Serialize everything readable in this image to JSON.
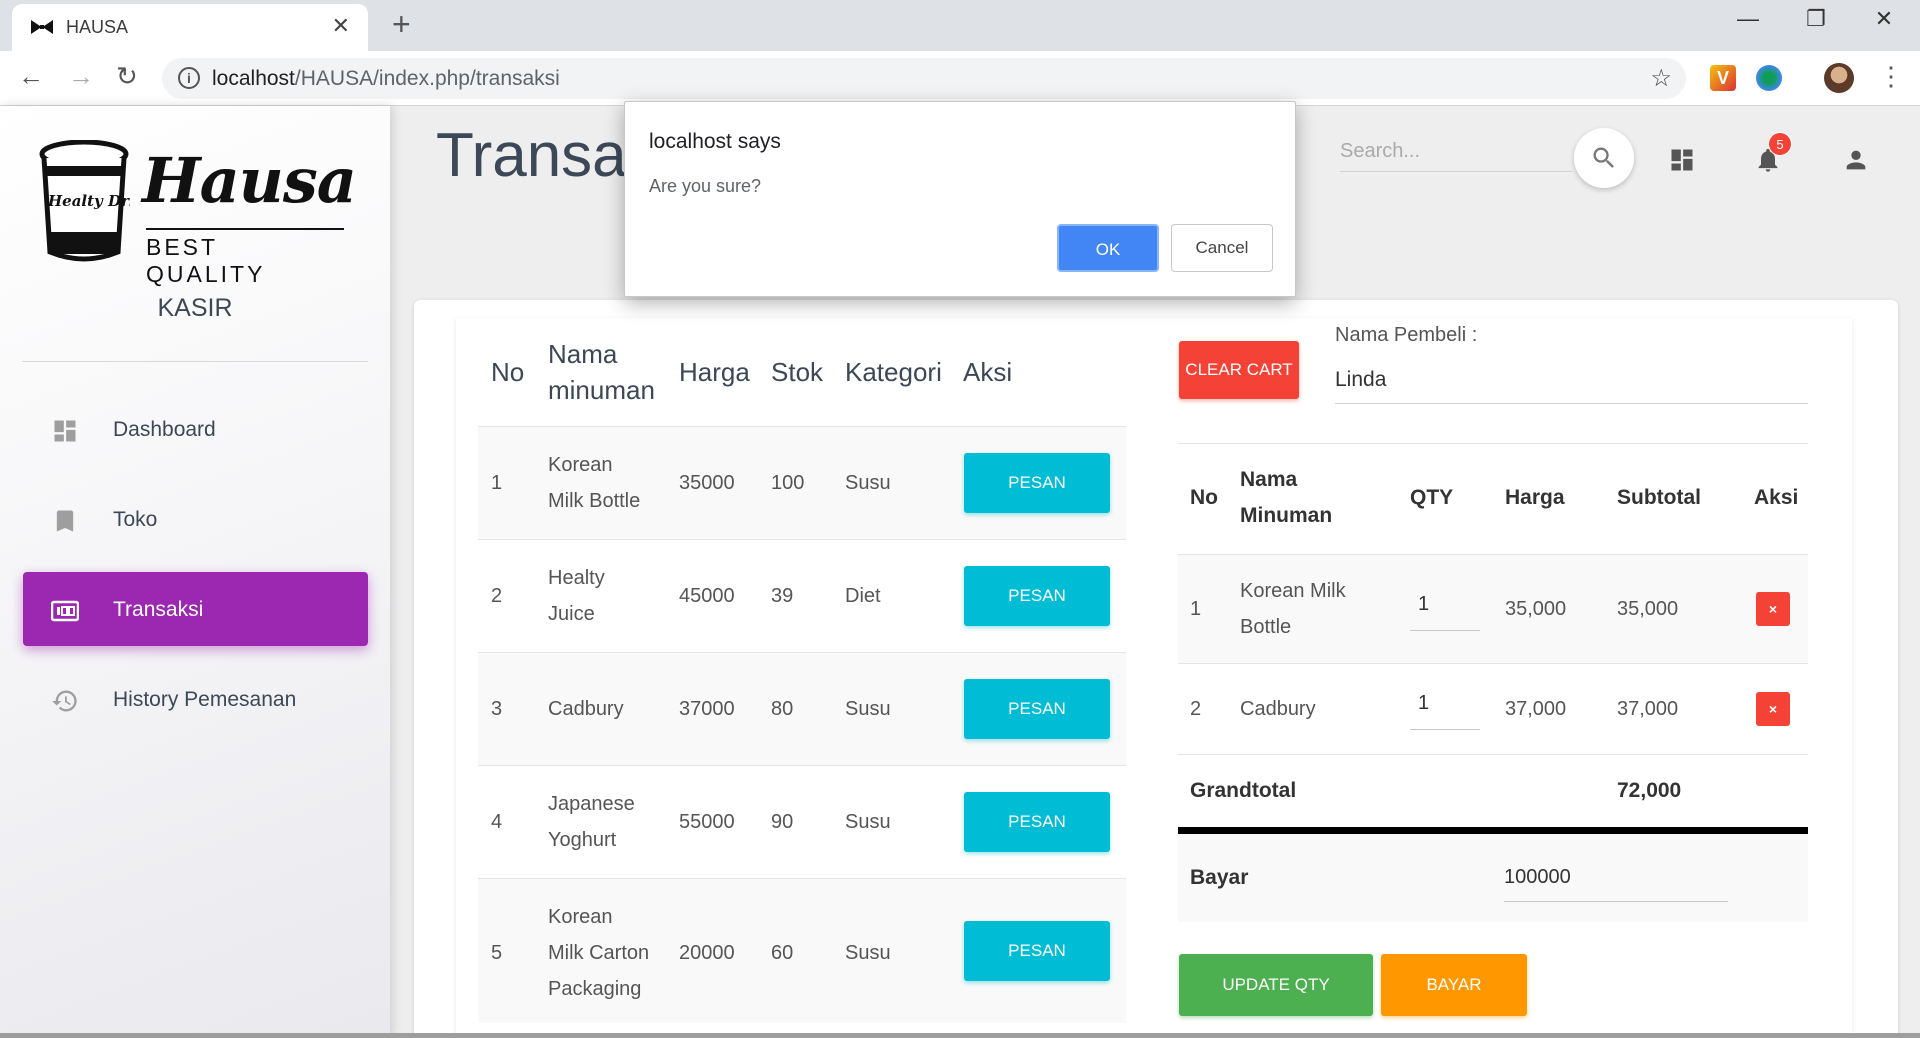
{
  "browser": {
    "tab_title": "HAUSA",
    "url_host": "localhost",
    "url_path": "/HAUSA/index.php/transaksi"
  },
  "sidebar": {
    "logo_word": "Hausa",
    "logo_sub": "BEST QUALITY",
    "logo_cup_text": "Healty Drink",
    "role": "KASIR",
    "items": [
      {
        "label": "Dashboard",
        "icon": "dashboard-icon",
        "active": false
      },
      {
        "label": "Toko",
        "icon": "bookmark-icon",
        "active": false
      },
      {
        "label": "Transaksi",
        "icon": "receipt-icon",
        "active": true
      },
      {
        "label": "History Pemesanan",
        "icon": "history-icon",
        "active": false
      }
    ]
  },
  "header": {
    "title": "Transal",
    "search_placeholder": "Search...",
    "notification_count": "5"
  },
  "products": {
    "headers": {
      "no": "No",
      "nama_1": "Nama",
      "nama_2": "minuman",
      "harga": "Harga",
      "stok": "Stok",
      "kategori": "Kategori",
      "aksi": "Aksi"
    },
    "button_label": "PESAN",
    "rows": [
      {
        "no": "1",
        "nama": [
          "Korean",
          "Milk Bottle"
        ],
        "harga": "35000",
        "stok": "100",
        "kategori": "Susu"
      },
      {
        "no": "2",
        "nama": [
          "Healty",
          "Juice"
        ],
        "harga": "45000",
        "stok": "39",
        "kategori": "Diet"
      },
      {
        "no": "3",
        "nama": [
          "Cadbury"
        ],
        "harga": "37000",
        "stok": "80",
        "kategori": "Susu"
      },
      {
        "no": "4",
        "nama": [
          "Japanese",
          "Yoghurt"
        ],
        "harga": "55000",
        "stok": "90",
        "kategori": "Susu"
      },
      {
        "no": "5",
        "nama": [
          "Korean",
          "Milk Carton",
          "Packaging"
        ],
        "harga": "20000",
        "stok": "60",
        "kategori": "Susu"
      }
    ]
  },
  "cart": {
    "clear_label": "CLEAR CART",
    "buyer_label": "Nama Pembeli :",
    "buyer_value": "Linda",
    "headers": {
      "no": "No",
      "nama_1": "Nama",
      "nama_2": "Minuman",
      "qty": "QTY",
      "harga": "Harga",
      "subtotal": "Subtotal",
      "aksi": "Aksi"
    },
    "rows": [
      {
        "no": "1",
        "nama": [
          "Korean Milk",
          "Bottle"
        ],
        "qty": "1",
        "harga": "35,000",
        "subtotal": "35,000"
      },
      {
        "no": "2",
        "nama": [
          "Cadbury"
        ],
        "qty": "1",
        "harga": "37,000",
        "subtotal": "37,000"
      }
    ],
    "remove_label": "×",
    "grandtotal_label": "Grandtotal",
    "grandtotal_value": "72,000",
    "bayar_label": "Bayar",
    "bayar_value": "100000",
    "update_label": "UPDATE QTY",
    "pay_label": "BAYAR"
  },
  "dialog": {
    "title": "localhost says",
    "message": "Are you sure?",
    "ok_label": "OK",
    "cancel_label": "Cancel"
  }
}
